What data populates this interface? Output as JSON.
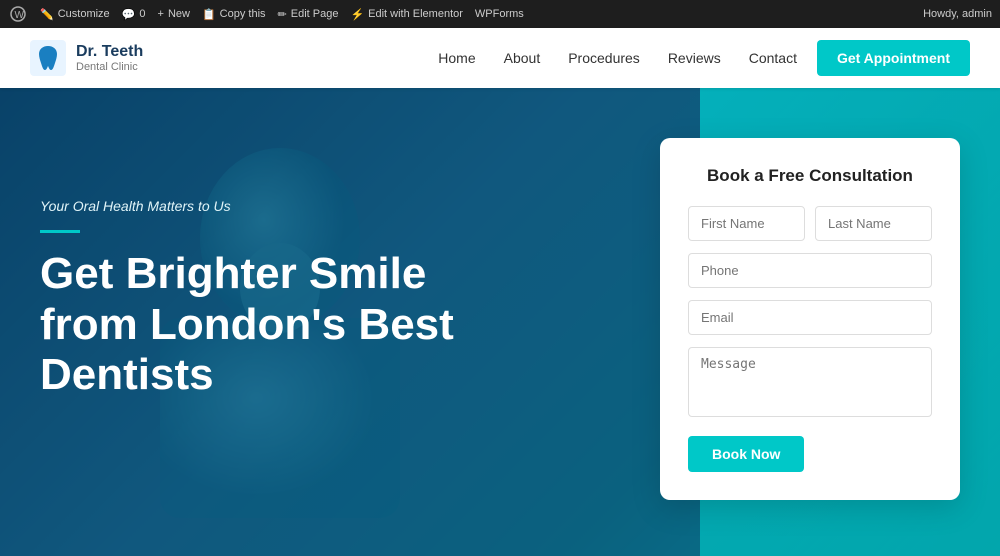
{
  "admin_bar": {
    "wp_label": "W",
    "customize_label": "Customize",
    "comments_label": "0",
    "new_label": "New",
    "copy_label": "Copy this",
    "edit_page_label": "Edit Page",
    "edit_elementor_label": "Edit with Elementor",
    "wpforms_label": "WPForms",
    "howdy_label": "Howdy, admin"
  },
  "header": {
    "logo_name": "Dr. Teeth",
    "logo_tagline": "Dental Clinic",
    "nav": {
      "home": "Home",
      "about": "About",
      "procedures": "Procedures",
      "reviews": "Reviews",
      "contact": "Contact"
    },
    "cta_button": "Get Appointment"
  },
  "hero": {
    "tagline": "Your Oral Health Matters to Us",
    "title_line1": "Get Brighter Smile",
    "title_line2": "from London's Best",
    "title_line3": "Dentists"
  },
  "form": {
    "title": "Book a Free Consultation",
    "first_name_placeholder": "First Name",
    "last_name_placeholder": "Last Name",
    "phone_placeholder": "Phone",
    "email_placeholder": "Email",
    "message_placeholder": "Message",
    "book_button": "Book Now"
  }
}
